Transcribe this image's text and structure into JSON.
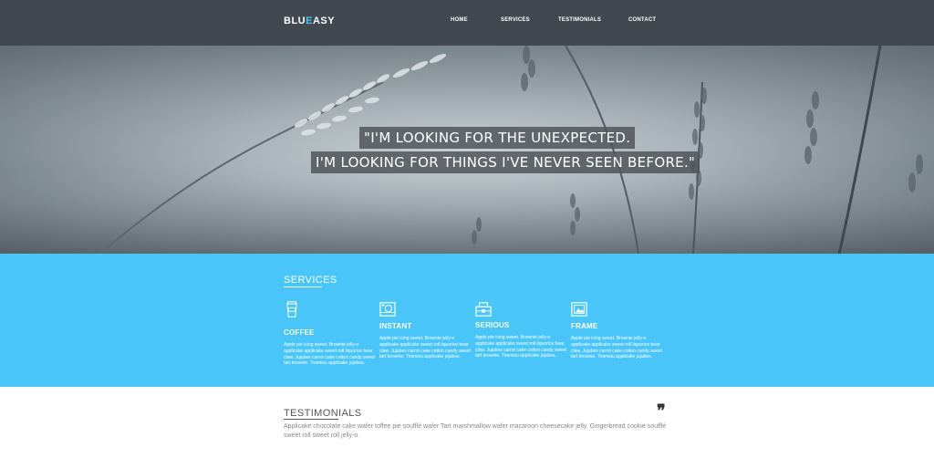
{
  "header": {
    "logo_part1": "BLU",
    "logo_part2": "E",
    "logo_part3": "ASY",
    "nav": [
      "HOME",
      "SERVICES",
      "TESTIMONIALS",
      "CONTACT"
    ]
  },
  "hero": {
    "line1": "\"I'M LOOKING FOR THE UNEXPECTED.",
    "line2": "I'M LOOKING FOR THINGS I'VE NEVER SEEN BEFORE.\""
  },
  "services": {
    "title": "SERVICES",
    "items": [
      {
        "name": "COFFEE",
        "icon": "coffee-cup-icon",
        "text": "Apple pie icing sweet. Brownie jelly-o applicake applicake sweet roll liquorice bear claw. Jujubes carrot cake cotton candy sweet tart brownie. Tiramisu applicake jujubes."
      },
      {
        "name": "INSTANT",
        "icon": "instant-camera-icon",
        "text": "Apple pie icing sweet. Brownie jelly-o applicake applicake sweet roll liquorice bear claw. Jujubes carrot cake cotton candy sweet tart brownie. Tiramisu applicake jujubes."
      },
      {
        "name": "SERIOUS",
        "icon": "briefcase-icon",
        "text": "Apple pie icing sweet. Brownie jelly-o applicake applicake sweet roll liquorice bear claw. Jujubes carrot cake cotton candy sweet tart brownie. Tiramisu applicake jujubes."
      },
      {
        "name": "FRAME",
        "icon": "picture-frame-icon",
        "text": "Apple pie icing sweet. Brownie jelly-o applicake applicake sweet roll liquorice bear claw. Jujubes carrot cake cotton candy sweet tart brownie. Tiramisu applicake jujubes."
      }
    ]
  },
  "testimonials": {
    "title": "TESTIMONIALS",
    "quote_mark": "❞",
    "text": "Applicake chocolate cake wafer toffee pie soufflé wafer Tart marshmallow wafer macaroon cheesecake jelly. Gingerbread cookie soufflé sweet roll sweet roll jelly-o."
  },
  "colors": {
    "accent": "#4ac6f5",
    "header_bg": "#41484f",
    "services_bg": "#4ac5f9"
  }
}
